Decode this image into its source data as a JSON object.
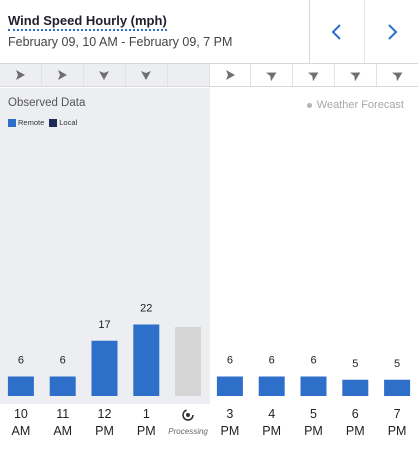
{
  "header": {
    "title": "Wind Speed Hourly (mph)",
    "subtitle": "February 09, 10 AM - February 09, 7 PM",
    "prev_icon": "chevron-left-icon",
    "next_icon": "chevron-right-icon"
  },
  "observed": {
    "title": "Observed Data",
    "legend": [
      {
        "label": "Remote",
        "color": "#2e6fca"
      },
      {
        "label": "Local",
        "color": "#1b2b55"
      }
    ]
  },
  "forecast": {
    "label": "Weather Forecast"
  },
  "colors": {
    "bar": "#2e6fca",
    "processing": "#d6d6d6",
    "arrow": "#6f6f6f"
  },
  "chart_data": {
    "type": "bar",
    "categories": [
      "10 AM",
      "11 AM",
      "12 PM",
      "1 PM",
      "Processing",
      "3 PM",
      "4 PM",
      "5 PM",
      "6 PM",
      "7 PM"
    ],
    "values": [
      6,
      6,
      17,
      22,
      null,
      6,
      6,
      6,
      5,
      5
    ],
    "value_labels": [
      "6",
      "6",
      "17",
      "22",
      "",
      "6",
      "6",
      "6",
      "5",
      "5"
    ],
    "wind_direction_icons": [
      "arrow-right",
      "arrow-right",
      "arrow-down",
      "arrow-down",
      "",
      "arrow-right",
      "arrow-up-right",
      "arrow-up-right",
      "arrow-up-right",
      "arrow-up-right"
    ],
    "ylim": [
      0,
      30
    ]
  },
  "time_axis": [
    {
      "line1": "10",
      "line2": "AM"
    },
    {
      "line1": "11",
      "line2": "AM"
    },
    {
      "line1": "12",
      "line2": "PM"
    },
    {
      "line1": "1",
      "line2": "PM"
    },
    {
      "line1": "",
      "line2": "Processing",
      "processing": true
    },
    {
      "line1": "3",
      "line2": "PM"
    },
    {
      "line1": "4",
      "line2": "PM"
    },
    {
      "line1": "5",
      "line2": "PM"
    },
    {
      "line1": "6",
      "line2": "PM"
    },
    {
      "line1": "7",
      "line2": "PM"
    }
  ]
}
